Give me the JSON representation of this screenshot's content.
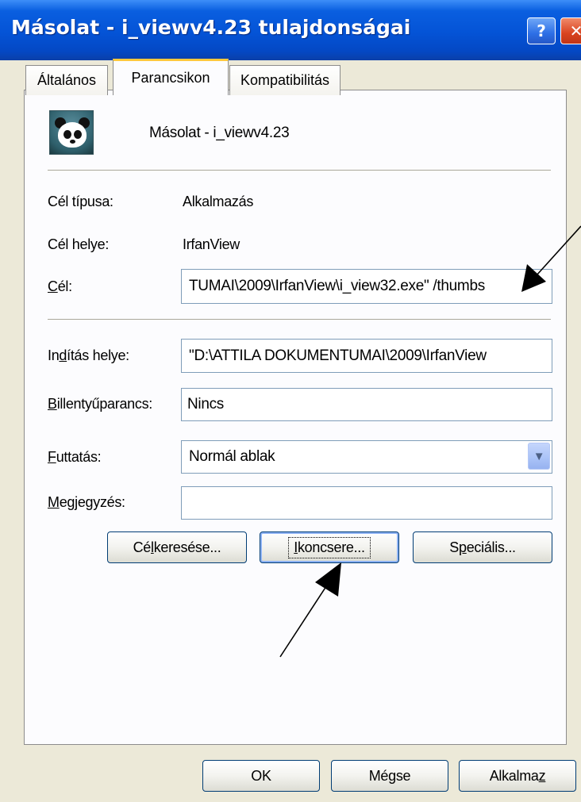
{
  "window": {
    "title": "Másolat - i_viewv4.23 tulajdonságai",
    "help_glyph": "?",
    "close_glyph": "✕"
  },
  "tabs": [
    {
      "label": "Általános",
      "active": false
    },
    {
      "label": "Parancsikon",
      "active": true
    },
    {
      "label": "Kompatibilitás",
      "active": false
    }
  ],
  "shortcut": {
    "name": "Másolat - i_viewv4.23",
    "icon": "panda-icon"
  },
  "fields": {
    "target_type_label": "Cél típusa:",
    "target_type_value": "Alkalmazás",
    "target_location_label": "Cél helye:",
    "target_location_value": "IrfanView",
    "target_label_pre": "",
    "target_label_ul": "C",
    "target_label_post": "él:",
    "target_value": "TUMAI\\2009\\IrfanView\\i_view32.exe\" /thumbs",
    "start_in_label_pre": "In",
    "start_in_label_ul": "d",
    "start_in_label_post": "ítás helye:",
    "start_in_value": "\"D:\\ATTILA DOKUMENTUMAI\\2009\\IrfanView",
    "hotkey_label_pre": "",
    "hotkey_label_ul": "B",
    "hotkey_label_post": "illentyűparancs:",
    "hotkey_value": "Nincs",
    "run_label_pre": "",
    "run_label_ul": "F",
    "run_label_post": "uttatás:",
    "run_value": "Normál ablak",
    "comment_label_pre": "",
    "comment_label_ul": "M",
    "comment_label_post": "egjegyzés:",
    "comment_value": ""
  },
  "buttons": {
    "find_target_pre": "Cé",
    "find_target_ul": "l",
    "find_target_post": " keresése...",
    "change_icon_pre": "",
    "change_icon_ul": "I",
    "change_icon_post": "koncsere...",
    "advanced_pre": "S",
    "advanced_ul": "p",
    "advanced_post": "eciális...",
    "ok": "OK",
    "cancel": "Mégse",
    "apply_pre": "Alkalma",
    "apply_ul": "z",
    "apply_post": ""
  },
  "colors": {
    "titlebar": "#0453d6",
    "dialog_bg": "#ece9d8",
    "active_tab_accent": "#ffc83c",
    "field_border": "#7f9db9"
  }
}
